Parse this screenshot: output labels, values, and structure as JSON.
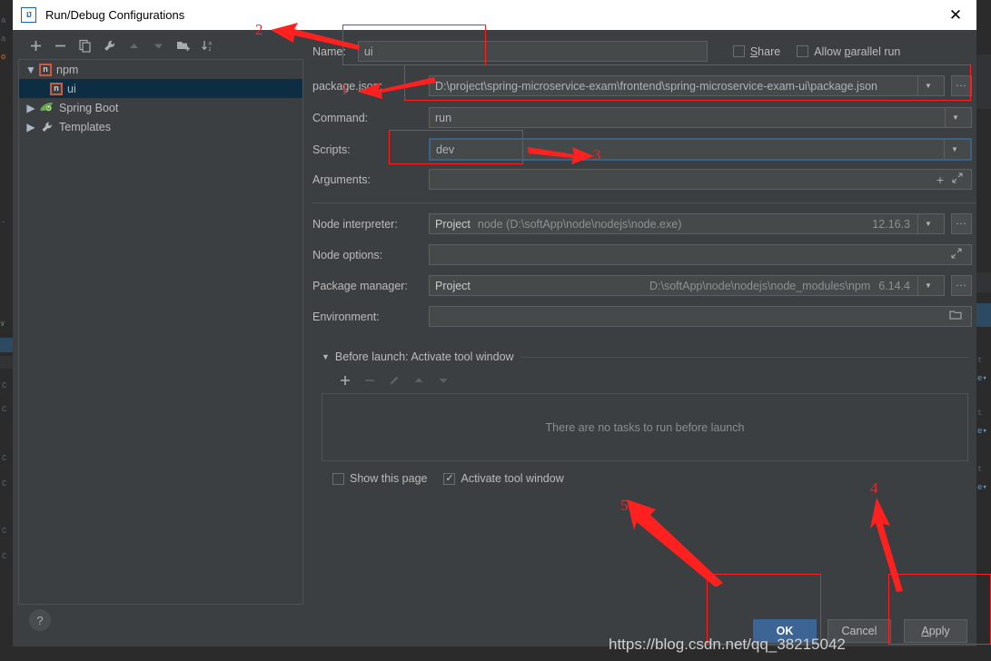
{
  "window": {
    "title": "Run/Debug Configurations",
    "logo_text": "IJ",
    "close_icon": "close-icon"
  },
  "tree_toolbar": [
    {
      "name": "add-configuration-button",
      "icon": "plus-icon"
    },
    {
      "name": "remove-configuration-button",
      "icon": "minus-icon"
    },
    {
      "name": "copy-configuration-button",
      "icon": "copy-icon"
    },
    {
      "name": "edit-templates-button",
      "icon": "wrench-icon"
    },
    {
      "name": "move-up-button",
      "icon": "arrow-up-icon"
    },
    {
      "name": "move-down-button",
      "icon": "arrow-down-icon"
    },
    {
      "name": "new-folder-button",
      "icon": "folder-add-icon"
    },
    {
      "name": "sort-configurations-button",
      "icon": "sort-az-icon"
    }
  ],
  "tree": {
    "items": [
      {
        "label": "npm",
        "icon": "npm-icon",
        "expanded": true,
        "level": 0,
        "selected": false
      },
      {
        "label": "ui",
        "icon": "npm-icon",
        "level": 1,
        "selected": true
      },
      {
        "label": "Spring Boot",
        "icon": "spring-boot-icon",
        "expanded": false,
        "level": 0,
        "selected": false
      },
      {
        "label": "Templates",
        "icon": "wrench-icon",
        "expanded": false,
        "level": 0,
        "selected": false
      }
    ]
  },
  "form": {
    "name_label": "Name:",
    "name_value": "ui",
    "share_label": "Share",
    "share_checked": false,
    "allow_parallel_label": "Allow parallel run",
    "allow_parallel_checked": false,
    "package_json_label": "package.json:",
    "package_json_value": "D:\\project\\spring-microservice-exam\\frontend\\spring-microservice-exam-ui\\package.json",
    "command_label": "Command:",
    "command_value": "run",
    "scripts_label": "Scripts:",
    "scripts_value": "dev",
    "arguments_label": "Arguments:",
    "arguments_value": "",
    "node_interpreter_label": "Node interpreter:",
    "node_interpreter_scope": "Project",
    "node_interpreter_value": "node (D:\\softApp\\node\\nodejs\\node.exe)",
    "node_interpreter_version": "12.16.3",
    "node_options_label": "Node options:",
    "node_options_value": "",
    "package_manager_label": "Package manager:",
    "package_manager_scope": "Project",
    "package_manager_value": "D:\\softApp\\node\\nodejs\\node_modules\\npm",
    "package_manager_version": "6.14.4",
    "environment_label": "Environment:",
    "environment_value": "",
    "browse_button_label": "...",
    "add_argument_icon": "plus-icon",
    "expand_icon": "expand-diagonal-icon",
    "folder_icon": "folder-icon",
    "dropdown_icon": "chevron-down-icon"
  },
  "before_launch": {
    "title": "Before launch: Activate tool window",
    "empty_text": "There are no tasks to run before launch",
    "toolbar": [
      {
        "name": "add-task-button",
        "icon": "plus-icon",
        "enabled": true
      },
      {
        "name": "remove-task-button",
        "icon": "minus-icon",
        "enabled": false
      },
      {
        "name": "edit-task-button",
        "icon": "pencil-icon",
        "enabled": false
      },
      {
        "name": "task-move-up-button",
        "icon": "arrow-up-icon",
        "enabled": false
      },
      {
        "name": "task-move-down-button",
        "icon": "arrow-down-icon",
        "enabled": false
      }
    ],
    "show_this_page_label": "Show this page",
    "show_this_page_checked": false,
    "activate_tool_window_label": "Activate tool window",
    "activate_tool_window_checked": true
  },
  "footer": {
    "help_label": "?",
    "ok_label": "OK",
    "cancel_label": "Cancel",
    "apply_label": "Apply"
  },
  "annotations": {
    "numbers": [
      "1",
      "2",
      "3",
      "4",
      "5"
    ],
    "watermark": "https://blog.csdn.net/qq_38215042",
    "color": "#ff1f1f"
  }
}
